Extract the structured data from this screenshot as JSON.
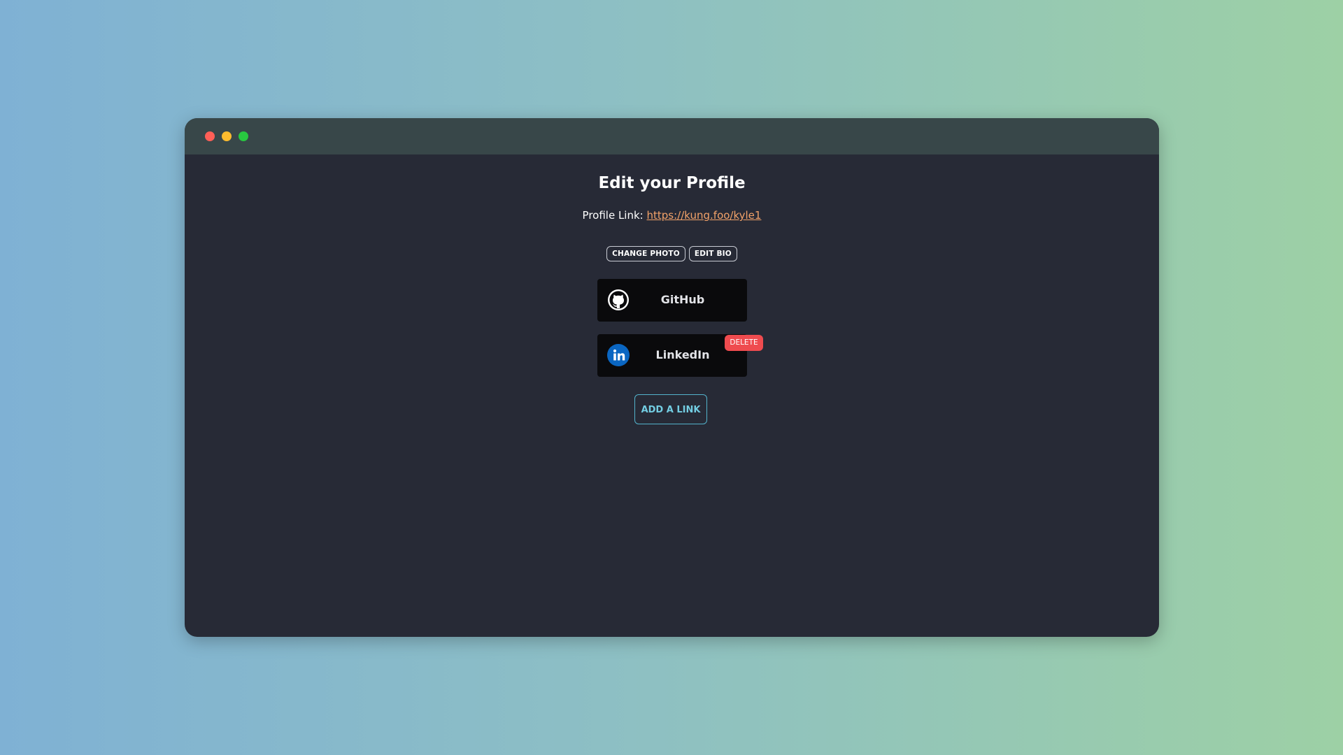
{
  "window": {
    "controls": [
      "close",
      "minimize",
      "maximize"
    ]
  },
  "page": {
    "title": "Edit your Profile",
    "profile_link_label": "Profile Link:",
    "profile_link_url": "https://kung.foo/kyle1"
  },
  "actions": {
    "change_photo": "CHANGE PHOTO",
    "edit_bio": "EDIT BIO"
  },
  "links": [
    {
      "label": "GitHub",
      "icon": "github-icon"
    },
    {
      "label": "LinkedIn",
      "icon": "linkedin-icon",
      "badge": "DELETE"
    }
  ],
  "add_link_label": "ADD A LINK",
  "colors": {
    "window_bg": "#272a36",
    "titlebar_bg": "#384749",
    "link_color": "#f2a269",
    "delete_badge": "#ef4b4f",
    "add_link_accent": "#53b3cc",
    "linkedin_blue": "#0a66c2"
  }
}
